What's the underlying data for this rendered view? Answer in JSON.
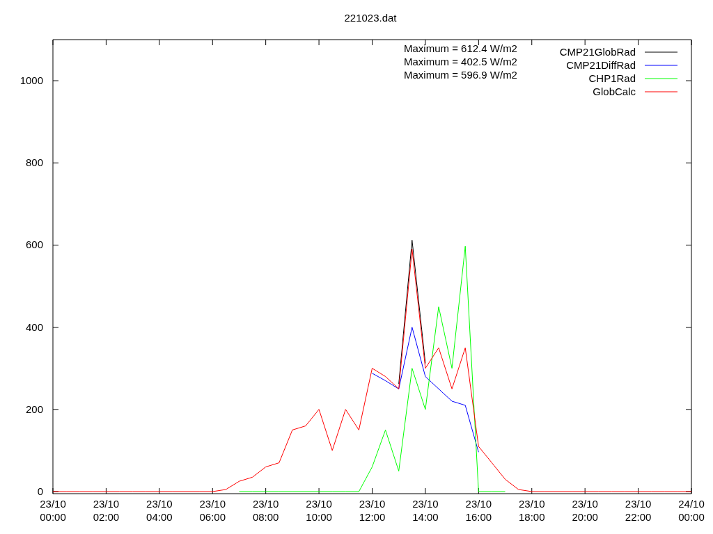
{
  "chart_data": {
    "type": "line",
    "title": "221023.dat",
    "categories": [
      "23/10 00:00",
      null,
      null,
      null,
      "23/10 02:00",
      null,
      null,
      null,
      "23/10 04:00",
      null,
      null,
      null,
      "23/10 06:00",
      null,
      null,
      null,
      "23/10 08:00",
      null,
      null,
      null,
      "23/10 10:00",
      null,
      null,
      null,
      "23/10 12:00",
      null,
      null,
      null,
      "23/10 14:00",
      null,
      null,
      null,
      "23/10 16:00",
      null,
      null,
      null,
      "23/10 18:00",
      null,
      null,
      null,
      "23/10 20:00",
      null,
      null,
      null,
      "23/10 22:00",
      null,
      null,
      null,
      "24/10 00:00"
    ],
    "series": [
      {
        "name": "CMP21GlobRad",
        "color": "#000000",
        "values": [
          null,
          null,
          null,
          null,
          null,
          null,
          null,
          null,
          null,
          null,
          null,
          null,
          null,
          null,
          null,
          null,
          null,
          null,
          null,
          null,
          null,
          null,
          null,
          null,
          null,
          null,
          262,
          612,
          312,
          null,
          null,
          null,
          null,
          null,
          null,
          null,
          null,
          null,
          null,
          null,
          null,
          null,
          null,
          null,
          null,
          null,
          null,
          null,
          null
        ]
      },
      {
        "name": "CMP21DiffRad",
        "color": "#0000ff",
        "values": [
          null,
          null,
          null,
          null,
          null,
          null,
          null,
          null,
          null,
          null,
          null,
          null,
          null,
          null,
          null,
          null,
          null,
          null,
          null,
          null,
          null,
          null,
          null,
          null,
          288,
          270,
          250,
          400,
          280,
          250,
          220,
          210,
          96,
          null,
          null,
          null,
          null,
          null,
          null,
          null,
          null,
          null,
          null,
          null,
          null,
          null,
          null,
          null,
          null
        ]
      },
      {
        "name": "CHP1Rad",
        "color": "#00ff00",
        "values": [
          null,
          null,
          null,
          null,
          null,
          null,
          null,
          null,
          null,
          null,
          null,
          null,
          null,
          null,
          0,
          0,
          0,
          0,
          0,
          0,
          0,
          0,
          0,
          0,
          60,
          150,
          50,
          300,
          200,
          450,
          300,
          597,
          0,
          0,
          0,
          null,
          null,
          null,
          null,
          null,
          null,
          null,
          null,
          null,
          null,
          null,
          null,
          null,
          null
        ]
      },
      {
        "name": "GlobCalc",
        "color": "#ff0000",
        "values": [
          0,
          0,
          0,
          0,
          0,
          0,
          0,
          0,
          0,
          0,
          0,
          0,
          0,
          5,
          25,
          35,
          60,
          70,
          150,
          160,
          200,
          100,
          200,
          150,
          300,
          280,
          250,
          590,
          300,
          350,
          250,
          350,
          110,
          70,
          30,
          5,
          0,
          0,
          0,
          0,
          0,
          0,
          0,
          0,
          0,
          0,
          0,
          0,
          0
        ]
      }
    ],
    "ylim": [
      0,
      1100
    ],
    "legend": true,
    "yticks": [
      0,
      200,
      400,
      600,
      800,
      1000
    ],
    "annotations": [
      "Maximum = 612.4 W/m2",
      "Maximum = 402.5 W/m2",
      "Maximum = 596.9 W/m2"
    ]
  }
}
